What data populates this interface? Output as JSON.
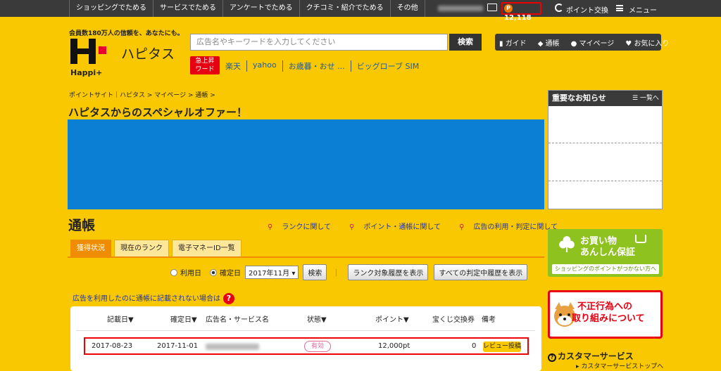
{
  "topnav": {
    "items": [
      "ショッピングでためる",
      "サービスでためる",
      "アンケートでためる",
      "クチコミ・紹介でためる",
      "その他"
    ],
    "points": "12,118",
    "exchange": "ポイント交換",
    "menu": "メニュー"
  },
  "header": {
    "tagline": "会員数180万人の信頼を、あなたにも。",
    "site_name": "ハピタス",
    "logo_text": "Happi+",
    "search_placeholder": "広告名やキーワードを入力してください",
    "search_button": "検索",
    "hot_badge_1": "急上昇",
    "hot_badge_2": "ワード",
    "hot_words": [
      "楽天",
      "yahoo",
      "お歳暮・おせ ...",
      "ビッグローブ SIM"
    ],
    "buttons": [
      "ガイド",
      "通帳",
      "マイページ",
      "お気に入り"
    ]
  },
  "breadcrumb": "ポイントサイト｜ハピタス > マイページ > 通帳 >",
  "offer_title": "ハピタスからのスペシャルオファー！",
  "tsucho": {
    "title": "通帳",
    "help_links": [
      "ランクに関して",
      "ポイント・通帳に関して",
      "広告の利用・判定に関して"
    ],
    "tabs": [
      "獲得状況",
      "現在のランク",
      "電子マネーID一覧"
    ],
    "filter": {
      "use_date": "利用日",
      "confirm_date": "確定日",
      "month": "2017年11月",
      "search": "検索",
      "rank_history": "ランク対象履歴を表示",
      "all_pending": "すべての判定中履歴を表示"
    },
    "notice": "広告を利用したのに通帳に記載されない場合は",
    "headers": [
      "記載日▼",
      "確定日▼",
      "広告名・サービス名",
      "状態▼",
      "ポイント▼",
      "宝くじ交換券",
      "備考"
    ],
    "row": {
      "date": "2017-08-23",
      "confirmed": "2017-11-01",
      "status": "有効",
      "points": "12,000pt",
      "lottery": "0",
      "note": "レビュー投稿"
    }
  },
  "sidebar": {
    "news_title": "重要なお知らせ",
    "news_all": "一覧へ",
    "safe_line1": "お買い物",
    "safe_line2": "あんしん保証",
    "safe_sub": "ショッピングのポイントがつかない方へ",
    "fraud_line1": "不正行為への",
    "fraud_line2": "取り組みについて",
    "cs_title": "カスタマーサービス",
    "cs_link": "カスタマーサービストップへ"
  }
}
